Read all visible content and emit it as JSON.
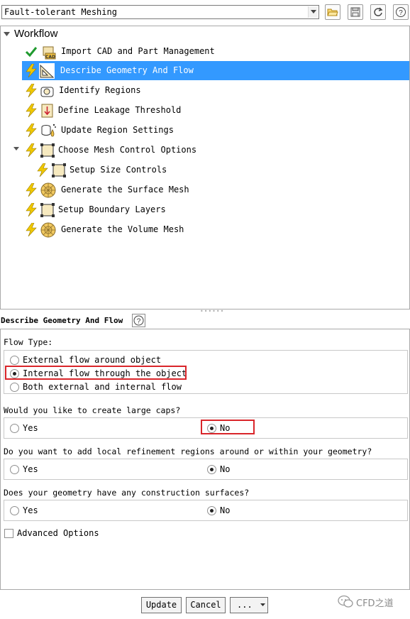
{
  "workflow_selector": {
    "value": "Fault-tolerant Meshing"
  },
  "toolbar_icons": [
    "open-folder-icon",
    "save-icon",
    "refresh-icon",
    "help-icon"
  ],
  "tree": {
    "header": "Workflow",
    "items": [
      {
        "label": "Import CAD and Part Management",
        "status": "check",
        "icon": "cad-import-icon"
      },
      {
        "label": "Describe Geometry And Flow",
        "status": "lightning",
        "icon": "geometry-ruler-icon",
        "selected": true
      },
      {
        "label": "Identify Regions",
        "status": "lightning",
        "icon": "region-icon"
      },
      {
        "label": "Define Leakage Threshold",
        "status": "lightning",
        "icon": "leakage-arrow-icon"
      },
      {
        "label": "Update Region Settings",
        "status": "lightning",
        "icon": "region-settings-icon"
      },
      {
        "label": "Choose Mesh Control Options",
        "status": "lightning",
        "icon": "mesh-control-icon",
        "expanded": true
      },
      {
        "label": "Setup Size Controls",
        "status": "lightning",
        "icon": "size-control-icon",
        "child": true
      },
      {
        "label": "Generate the Surface Mesh",
        "status": "lightning",
        "icon": "surface-mesh-icon"
      },
      {
        "label": "Setup Boundary Layers",
        "status": "lightning",
        "icon": "boundary-layer-icon"
      },
      {
        "label": "Generate the Volume Mesh",
        "status": "lightning",
        "icon": "volume-mesh-icon"
      }
    ]
  },
  "task": {
    "title": "Describe Geometry And Flow",
    "flow_type": {
      "label": "Flow Type:",
      "options": [
        "External flow around object",
        "Internal flow through the object",
        "Both external and internal flow"
      ],
      "selected": "Internal flow through the object"
    },
    "large_caps": {
      "question": "Would you like to create large caps?",
      "yes": "Yes",
      "no": "No",
      "selected": "No"
    },
    "local_refinement": {
      "question": "Do you want to add local refinement regions around or within your geometry?",
      "yes": "Yes",
      "no": "No",
      "selected": "No"
    },
    "construction_surfaces": {
      "question": "Does your geometry have any construction surfaces?",
      "yes": "Yes",
      "no": "No",
      "selected": "No"
    },
    "advanced_options": {
      "label": "Advanced Options",
      "checked": false
    }
  },
  "buttons": {
    "update": "Update",
    "cancel": "Cancel",
    "more": "..."
  },
  "watermark": "CFD之道",
  "colors": {
    "selection": "#3399ff",
    "lightning": "#f0c800",
    "check": "#1f9a2e",
    "highlight_box": "#d9252a"
  }
}
